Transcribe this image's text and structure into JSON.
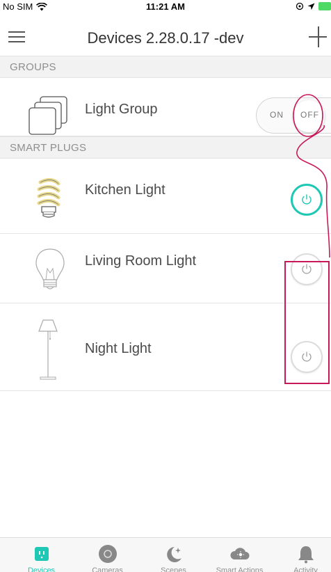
{
  "status_bar": {
    "carrier": "No SIM",
    "time": "11:21 AM"
  },
  "nav": {
    "title": "Devices 2.28.0.17 -dev",
    "menu_icon": "hamburger-icon",
    "add_icon": "plus-icon"
  },
  "sections": [
    {
      "header": "GROUPS",
      "devices": [
        {
          "name": "Light Group",
          "icon": "light-group-icon",
          "control": "toggle",
          "toggle_on_label": "ON",
          "toggle_off_label": "OFF",
          "state": "off"
        }
      ]
    },
    {
      "header": "SMART PLUGS",
      "devices": [
        {
          "name": "Kitchen Light",
          "icon": "cfl-bulb-icon",
          "control": "power",
          "state": "on"
        },
        {
          "name": "Living Room Light",
          "icon": "light-bulb-icon",
          "control": "power",
          "state": "off"
        },
        {
          "name": "Night Light",
          "icon": "floor-lamp-icon",
          "control": "power",
          "state": "off"
        }
      ]
    }
  ],
  "tabs": [
    {
      "label": "Devices",
      "icon": "plug-icon",
      "active": true
    },
    {
      "label": "Cameras",
      "icon": "camera-icon",
      "active": false
    },
    {
      "label": "Scenes",
      "icon": "moon-icon",
      "active": false
    },
    {
      "label": "Smart Actions",
      "icon": "cloud-icon",
      "active": false
    },
    {
      "label": "Activity",
      "icon": "bell-icon",
      "active": false
    }
  ],
  "colors": {
    "accent": "#1ec8b4",
    "annotation": "#c8185a",
    "section_bg": "#f2f2f2"
  }
}
